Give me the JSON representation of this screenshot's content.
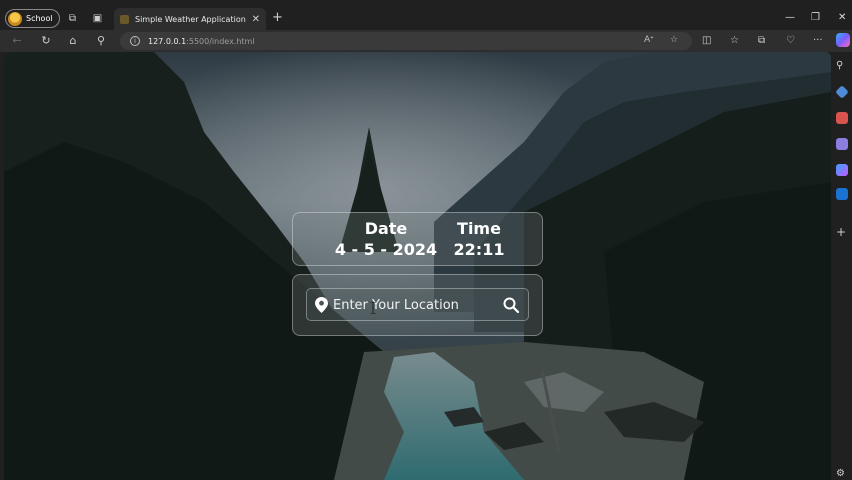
{
  "browser": {
    "profile_label": "School",
    "tab_title": "Simple Weather Application",
    "url_host": "127.0.0.1",
    "url_rest": ":5500/index.html"
  },
  "weather_app": {
    "date_label": "Date",
    "date_value": "4 - 5 - 2024",
    "time_label": "Time",
    "time_value": "22:11",
    "search_placeholder": "Enter Your Location"
  },
  "icons": {
    "tab_actions": [
      "workspaces-icon",
      "vertical-tabs-icon"
    ],
    "nav": [
      "back-icon",
      "refresh-icon",
      "home-icon",
      "search-icon"
    ],
    "omnibox": [
      "site-info-icon",
      "read-aloud-icon",
      "favorite-star-icon"
    ],
    "toolbar": [
      "split-screen-icon",
      "favorites-icon",
      "collections-icon",
      "browser-essentials-icon",
      "more-icon"
    ],
    "app": [
      "location-pin-icon",
      "search-icon"
    ]
  }
}
